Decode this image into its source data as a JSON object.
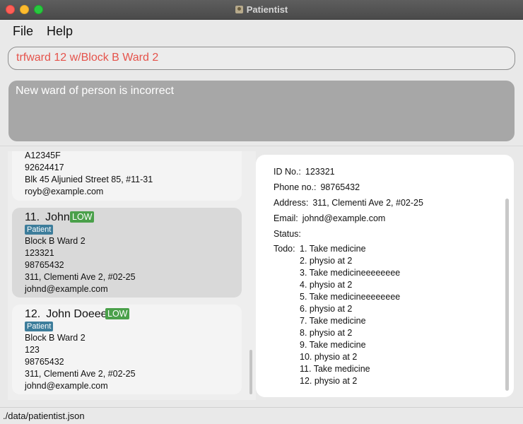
{
  "window": {
    "title": "Patientist"
  },
  "menu": {
    "file": "File",
    "help": "Help"
  },
  "command": {
    "value": "trfward 12 w/Block B Ward 2"
  },
  "result": {
    "message": "New ward of person is incorrect"
  },
  "list": {
    "partial": {
      "id": "A12345F",
      "phone": "92624417",
      "address": "Blk 45 Aljunied Street 85, #11-31",
      "email": "royb@example.com"
    },
    "cards": [
      {
        "index": "11.",
        "name": "John",
        "priority": "LOW",
        "type": "Patient",
        "ward": "Block B Ward 2",
        "id": "123321",
        "phone": "98765432",
        "address": "311, Clementi Ave 2, #02-25",
        "email": "johnd@example.com"
      },
      {
        "index": "12.",
        "name": "John Doeee",
        "priority": "LOW",
        "type": "Patient",
        "ward": "Block B Ward 2",
        "id": "123",
        "phone": "98765432",
        "address": "311, Clementi Ave 2, #02-25",
        "email": "johnd@example.com"
      }
    ]
  },
  "details": {
    "id_label": "ID No.:",
    "id_value": "123321",
    "phone_label": "Phone no.:",
    "phone_value": "98765432",
    "address_label": "Address:",
    "address_value": "311, Clementi Ave 2, #02-25",
    "email_label": "Email:",
    "email_value": "johnd@example.com",
    "status_label": "Status:",
    "todo_label": "Todo:",
    "todos": [
      "1. Take medicine",
      "2. physio at 2",
      "3. Take medicineeeeeeee",
      "4. physio at 2",
      "5. Take medicineeeeeeee",
      "6. physio at 2",
      "7. Take medicine",
      "8. physio at 2",
      "9. Take medicine",
      "10. physio at 2",
      "11. Take medicine",
      "12. physio at 2"
    ]
  },
  "status_bar": {
    "path": "./data/patientist.json"
  }
}
